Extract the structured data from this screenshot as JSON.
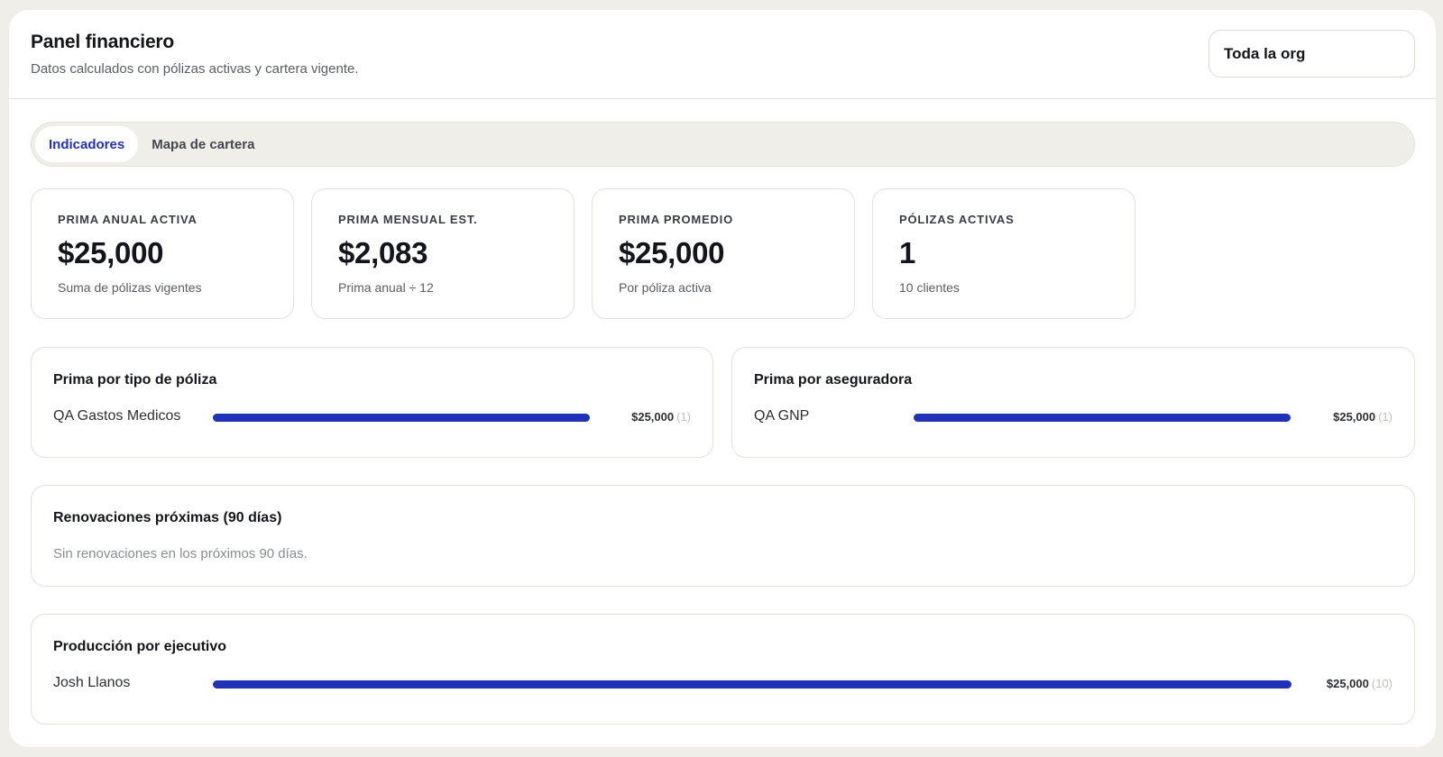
{
  "header": {
    "title": "Panel financiero",
    "subtitle": "Datos calculados con pólizas activas y cartera vigente.",
    "org_select": "Toda la org"
  },
  "tabs": [
    {
      "label": "Indicadores",
      "active": true
    },
    {
      "label": "Mapa de cartera",
      "active": false
    }
  ],
  "kpis": [
    {
      "label": "PRIMA ANUAL ACTIVA",
      "value": "$25,000",
      "note": "Suma de pólizas vigentes"
    },
    {
      "label": "PRIMA MENSUAL EST.",
      "value": "$2,083",
      "note": "Prima anual ÷ 12"
    },
    {
      "label": "PRIMA PROMEDIO",
      "value": "$25,000",
      "note": "Por póliza activa"
    },
    {
      "label": "PÓLIZAS ACTIVAS",
      "value": "1",
      "note": "10 clientes"
    }
  ],
  "by_policy_type": {
    "title": "Prima por tipo de póliza",
    "rows": [
      {
        "label": "QA Gastos Medicos",
        "value": "$25,000",
        "count": "(1)",
        "fraction": 1.0
      }
    ]
  },
  "by_insurer": {
    "title": "Prima por aseguradora",
    "rows": [
      {
        "label": "QA GNP",
        "value": "$25,000",
        "count": "(1)",
        "fraction": 1.0
      }
    ]
  },
  "renewals": {
    "title": "Renovaciones próximas (90 días)",
    "empty_text": "Sin renovaciones en los próximos 90 días."
  },
  "by_executive": {
    "title": "Producción por ejecutivo",
    "rows": [
      {
        "label": "Josh Llanos",
        "value": "$25,000",
        "count": "(10)",
        "fraction": 1.0
      }
    ]
  },
  "colors": {
    "accent": "#1f32b8",
    "background": "#efeee9",
    "card": "#ffffff"
  }
}
